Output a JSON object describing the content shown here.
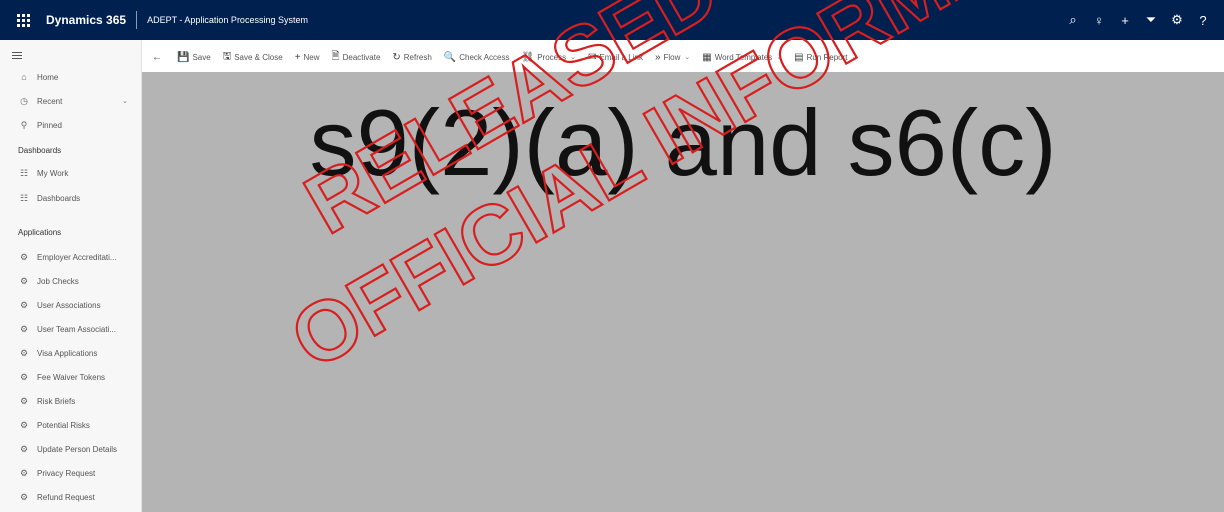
{
  "topbar": {
    "brand": "Dynamics 365",
    "app_title": "ADEPT - Application Processing System",
    "icons": [
      "search-icon",
      "lightbulb-icon",
      "plus-icon",
      "filter-icon",
      "gear-icon",
      "help-icon"
    ],
    "icon_glyphs": [
      "⌕",
      "♀",
      "+",
      "⏷",
      "⚙",
      "?"
    ]
  },
  "commandbar": {
    "back": "←",
    "items": [
      {
        "label": "Save",
        "icon": "💾"
      },
      {
        "label": "Save & Close",
        "icon": "🖫"
      },
      {
        "label": "New",
        "icon": "+"
      },
      {
        "label": "Deactivate",
        "icon": "🗎"
      },
      {
        "label": "Refresh",
        "icon": "↻"
      },
      {
        "label": "Check Access",
        "icon": "🔍"
      },
      {
        "label": "Process",
        "icon": "⛓"
      },
      {
        "label": "Email a Link",
        "icon": "✉"
      },
      {
        "label": "Flow",
        "icon": "»"
      },
      {
        "label": "Word Templates",
        "icon": "▦"
      },
      {
        "label": "Run Report",
        "icon": "▤"
      }
    ]
  },
  "sidebar": {
    "top_items": [
      {
        "label": "Home",
        "icon": "⌂"
      },
      {
        "label": "Recent",
        "icon": "◷"
      },
      {
        "label": "Pinned",
        "icon": "⚲"
      }
    ],
    "dashboards_header": "Dashboards",
    "dashboard_items": [
      {
        "label": "My Work",
        "icon": "☷"
      },
      {
        "label": "Dashboards",
        "icon": "☷"
      }
    ],
    "applications_header": "Applications",
    "application_items": [
      "Employer Accreditati...",
      "Job Checks",
      "User Associations",
      "User Team Associati...",
      "Visa Applications",
      "Fee Waiver Tokens",
      "Risk Briefs",
      "Potential Risks",
      "Update Person Details",
      "Privacy Request",
      "Refund Request"
    ],
    "app_icon": "⚙"
  },
  "main": {
    "redaction_text": "s9(2)(a) and s6(c)"
  },
  "watermark": {
    "line1": "RELEASED UNDER THE",
    "line2": "OFFICIAL INFORMATION ACT",
    "color": "#d81e1e"
  }
}
